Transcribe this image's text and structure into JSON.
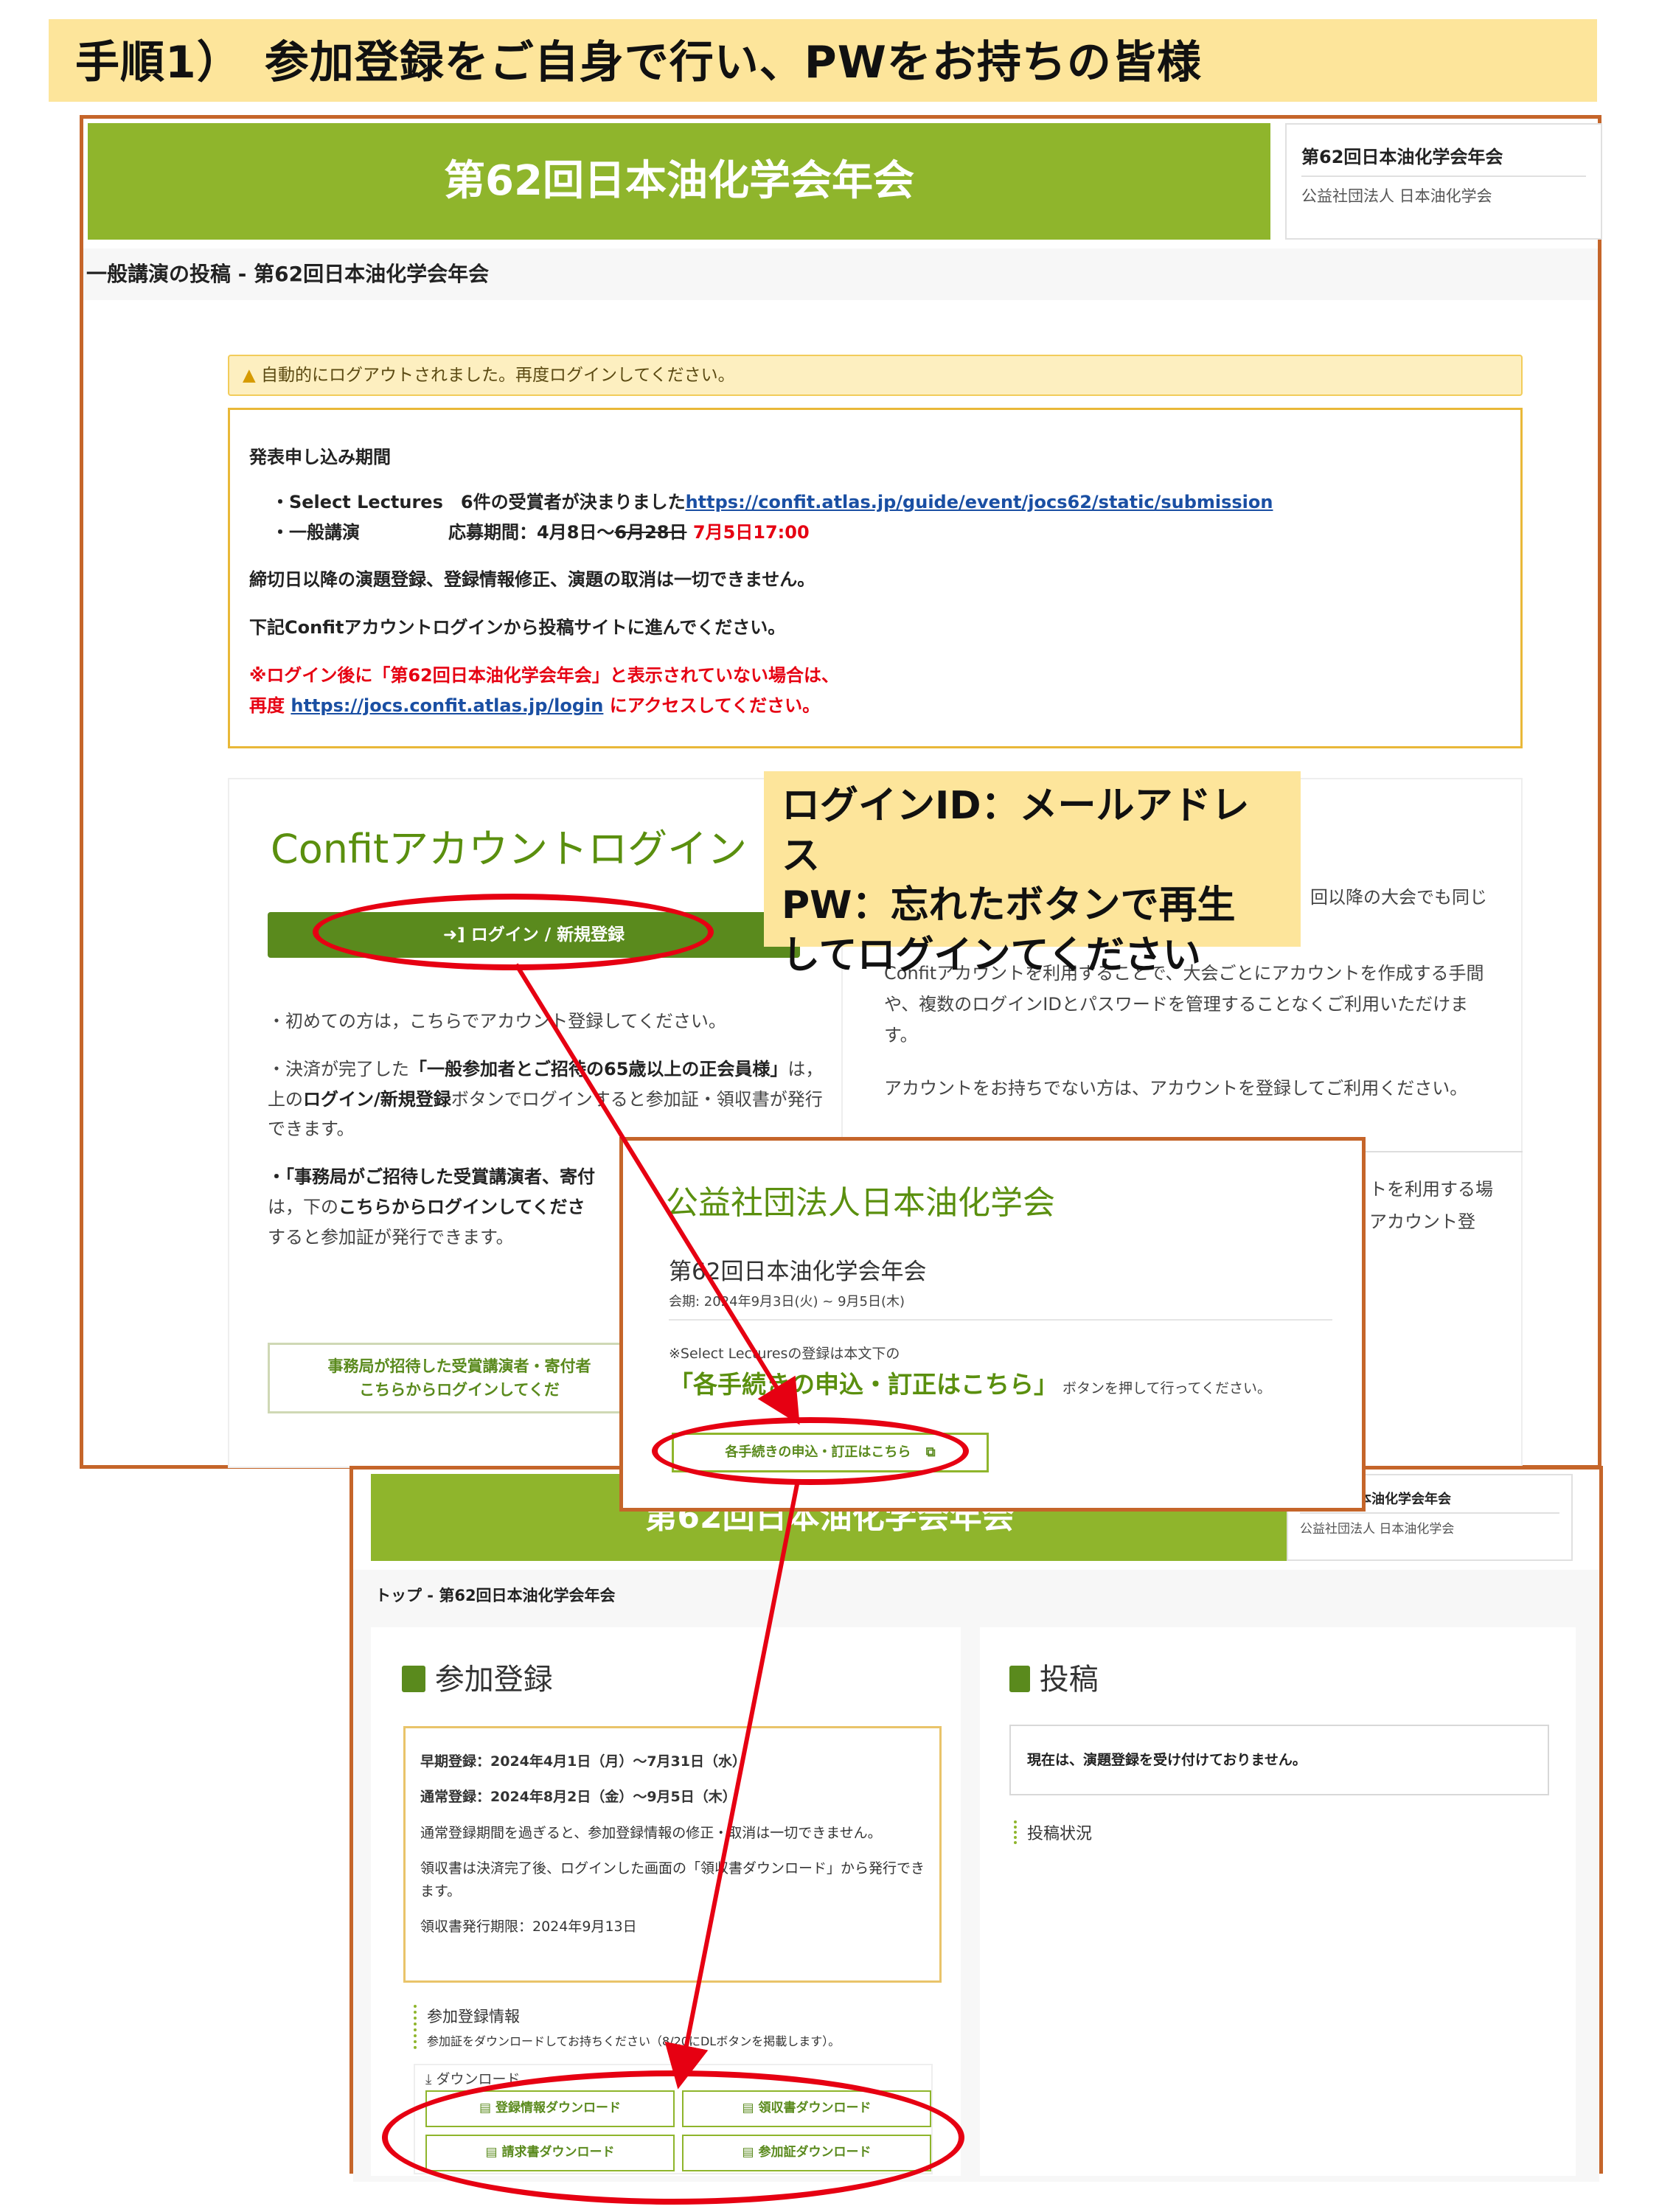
{
  "step_title": "手順1）　参加登録をご自身で行い、PWをお持ちの皆様",
  "screen1": {
    "banner_title": "第62回日本油化学会年会",
    "side_title": "第62回日本油化学会年会",
    "side_org": "公益社団法人 日本油化学会",
    "breadcrumb": "一般講演の投稿 - 第62回日本油化学会年会",
    "warning": "自動的にログアウトされました。再度ログインしてください。",
    "notice": {
      "period_heading": "発表申し込み期間",
      "item1_label": "・Select Lectures　6件の受賞者が決まりました",
      "item1_link": "https://confit.atlas.jp/guide/event/jocs62/static/submission",
      "item2_label": "・一般講演",
      "item2_period": "応募期間：4月8日〜",
      "item2_strike": "6月28日",
      "item2_new": "7月5日17:00",
      "line3": "締切日以降の演題登録、登録情報修正、演題の取消は一切できません。",
      "line4": "下記Confitアカウントログインから投稿サイトに進んでください。",
      "red1": "※ログイン後に「第62回日本油化学会年会」と表示されていない場合は、",
      "red2_pre": "再度 ",
      "red2_link": "https://jocs.confit.atlas.jp/login",
      "red2_post": " にアクセスしてください。"
    },
    "login": {
      "title": "Confitアカウントログイン",
      "button": "ログイン / 新規登録",
      "p1": "・初めての方は，こちらでアカウント登録してください。",
      "p2_a": "・決済が完了した",
      "p2_b": "「一般参加者とご招待の65歳以上の正会員様」",
      "p2_c": "は，上の",
      "p2_d": "ログイン/新規登録",
      "p2_e": "ボタンでログインすると参加証・領収書が発行できます。",
      "p3_a": "・「事務局がご招待した受賞講演者、寄付",
      "p3_b": "は，下の",
      "p3_c": "こちらからログインしてくださ",
      "p3_d": "すると参加証が発行できます。",
      "bottom_btn_1": "事務局が招待した受賞講演者・寄付者",
      "bottom_btn_2": "こちらからログインしてくだ"
    },
    "right": {
      "r1": "回以降の大会でも同じ",
      "r2": "Confitアカウントを利用することで、大会ごとにアカウントを作成する手間や、複数のログインIDとパスワードを管理することなくご利用いただけます。",
      "r3": "アカウントをお持ちでない方は、アカウントを登録してご利用ください。",
      "r4": "トを利用する場",
      "r5": "アカウント登"
    }
  },
  "callout": {
    "line1": "ログインID：メールアドレス",
    "line2": "PW：忘れたボタンで再生",
    "line3": "してログインてください"
  },
  "screen2": {
    "org_title": "公益社団法人日本油化学会",
    "event_title": "第62回日本油化学会年会",
    "dates": "会期: 2024年9月3日(火) ~ 9月5日(木)",
    "note_pre": "※Select Lecturesの登録は本文下の",
    "note_big": "「各手続きの申込・訂正はこちら」",
    "note_post": "ボタンを押して行ってください。",
    "button": "各手続きの申込・訂正はこちら"
  },
  "screen3": {
    "banner_title": "第62回日本油化学会年会",
    "side_title": "第62回日本油化学会年会",
    "side_org": "公益社団法人 日本油化学会",
    "breadcrumb": "トップ - 第62回日本油化学会年会",
    "reg": {
      "title": "参加登録",
      "early": "早期登録：2024年4月1日（月）〜7月31日（水）",
      "normal": "通常登録：2024年8月2日（金）〜9月5日（木）",
      "l3": "通常登録期間を過ぎると、参加登録情報の修正・取消は一切できません。",
      "l4": "領収書は決済完了後、ログインした画面の「領収書ダウンロード」から発行できます。",
      "l5": "領収書発行期限：2024年9月13日",
      "info_title": "参加登録情報",
      "info_sub": "参加証をダウンロードしてお持ちください（8/20にDLボタンを掲載します）。",
      "dl_label": "ダウンロード",
      "btn1": "登録情報ダウンロード",
      "btn2": "領収書ダウンロード",
      "btn3": "請求書ダウンロード",
      "btn4": "参加証ダウンロード"
    },
    "post": {
      "title": "投稿",
      "box": "現在は、演題登録を受け付けておりません。",
      "status": "投稿状況"
    }
  },
  "colors": {
    "accent_green": "#8fb52c",
    "frame": "#c5652a",
    "highlight_red": "#e60012",
    "callout_bg": "#fde59b"
  }
}
